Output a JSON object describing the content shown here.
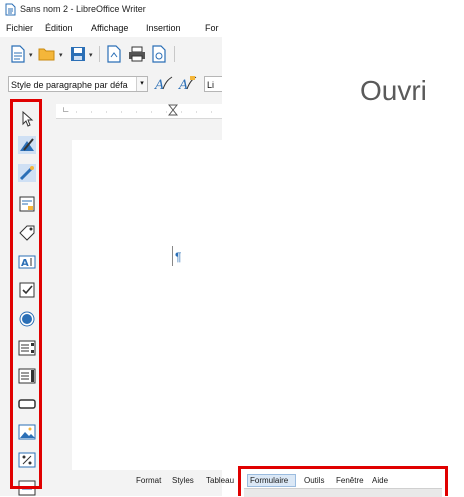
{
  "window": {
    "title": "Sans nom 2 - LibreOffice Writer",
    "menu": [
      "Fichier",
      "Édition",
      "Affichage",
      "Insertion",
      "For"
    ]
  },
  "toolbar2": {
    "paragraph_style": "Style de paragraphe par défa",
    "font_name": "Li"
  },
  "form_controls_toolbar": {
    "icons": [
      "select-pointer-icon",
      "design-mode-icon",
      "control-wizards-icon",
      "form-design-icon",
      "label-field-icon",
      "text-box-icon",
      "check-box-icon",
      "option-button-icon",
      "list-box-icon",
      "combo-box-icon",
      "push-button-icon",
      "image-button-icon",
      "formatted-field-icon",
      "more-controls-icon"
    ]
  },
  "right_panel": {
    "heading": "Ouvri"
  },
  "bottom_menu_left": [
    "Format",
    "Styles",
    "Tableau"
  ],
  "bottom_menu_right": [
    "Formulaire",
    "Outils",
    "Fenêtre",
    "Aide"
  ],
  "colors": {
    "highlight_border": "#e00000",
    "accent_blue": "#2b6fb6"
  }
}
